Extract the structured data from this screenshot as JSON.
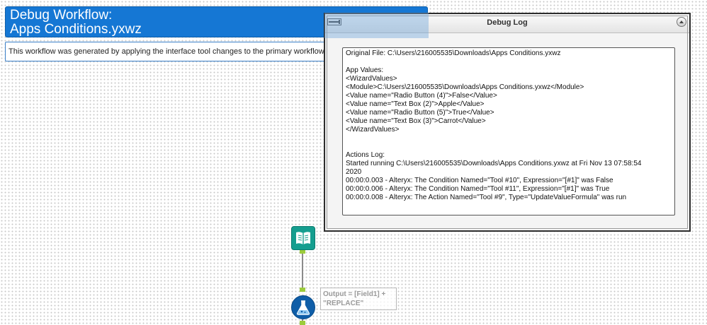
{
  "banner": {
    "title_line1": "Debug Workflow:",
    "title_line2": "Apps Conditions.yxwz"
  },
  "description": "This workflow was generated by applying the interface tool changes to the primary workflow.",
  "debug_log": {
    "title": "Debug Log",
    "lines": [
      "Original File: C:\\Users\\216005535\\Downloads\\Apps Conditions.yxwz",
      "",
      "App Values:",
      "<WizardValues>",
      "<Module>C:\\Users\\216005535\\Downloads\\Apps Conditions.yxwz</Module>",
      "<Value name=\"Radio Button (4)\">False</Value>",
      "<Value name=\"Text Box (2)\">Apple</Value>",
      "<Value name=\"Radio Button (5)\">True</Value>",
      "<Value name=\"Text Box (3)\">Carrot</Value>",
      "</WizardValues>",
      "",
      "",
      "Actions Log:",
      "Started running C:\\Users\\216005535\\Downloads\\Apps Conditions.yxwz at Fri Nov 13 07:58:54",
      "2020",
      "00:00:0.003 - Alteryx: The Condition Named=\"Tool #10\", Expression=\"[#1]\" was False",
      "00:00:0.006 - Alteryx: The Condition Named=\"Tool #11\", Expression=\"[#1]\" was True",
      "00:00:0.008 - Alteryx: The Action Named=\"Tool #9\", Type=\"UpdateValueFormula\" was run"
    ]
  },
  "tools": {
    "input_tool_icon": "book-icon",
    "formula_tool_icon": "flask-icon"
  },
  "annotation": {
    "line1": "Output = [Field1] +",
    "line2": "\"REPLACE\""
  },
  "colors": {
    "banner_blue": "#1577d4",
    "input_tool_teal": "#159e8f",
    "formula_tool_blue": "#0f5ea8",
    "anchor_green": "#9ccc3c"
  }
}
